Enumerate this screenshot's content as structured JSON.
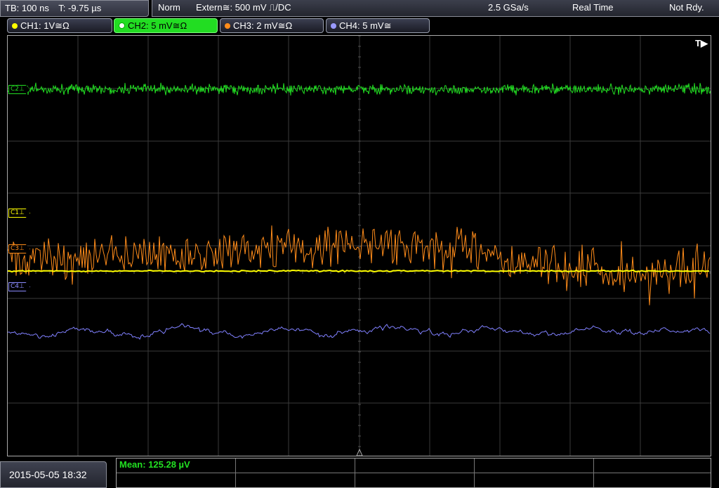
{
  "topbar": {
    "timebase": "TB: 100 ns",
    "trigger_time": "T: -9.75 µs",
    "mode": "Norm",
    "trigger_source": "Extern≅: 500 mV ⎍/DC",
    "sample_rate": "2.5 GSa/s",
    "acq_mode": "Real Time",
    "status": "Not Rdy."
  },
  "channels": [
    {
      "label": "CH1: 1V≅Ω",
      "color": "#ffff00",
      "active": false
    },
    {
      "label": "CH2: 5 mV≅Ω",
      "color": "#22dd22",
      "active": true
    },
    {
      "label": "CH3: 2 mV≅Ω",
      "color": "#ff8c1a",
      "active": false
    },
    {
      "label": "CH4: 5 mV≅",
      "color": "#8c8cff",
      "active": false
    }
  ],
  "markers": {
    "c1": "C1⊥",
    "c2": "C2⊥",
    "c3": "C3⊥",
    "c4": "C4⊥",
    "trigger": "T▶"
  },
  "colors": {
    "ch1": "#ffff00",
    "ch2": "#22dd22",
    "ch3": "#ff8c1a",
    "ch4": "#8080ff",
    "grid": "#3a3a3a"
  },
  "footer": {
    "datetime": "2015-05-05 18:32",
    "mean": "Mean: 125.28 µV"
  }
}
